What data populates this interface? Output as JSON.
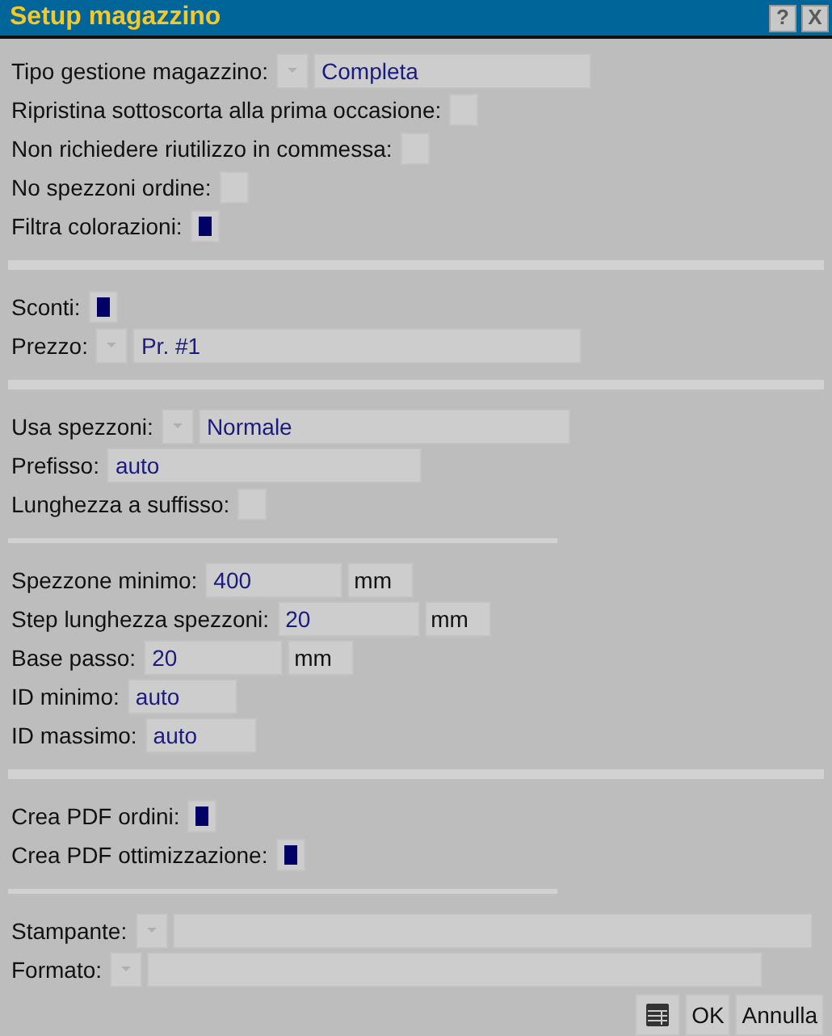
{
  "window": {
    "title": "Setup magazzino",
    "buttons": [
      "?",
      "X"
    ]
  },
  "sections": [
    {
      "rows": [
        {
          "kind": "dropdown",
          "label": "Tipo gestione magazzino:",
          "value": "Completa"
        },
        {
          "kind": "checkbox",
          "label": "Ripristina sottoscorta alla prima occasione:",
          "checked": false
        },
        {
          "kind": "checkbox",
          "label": "Non richiedere riutilizzo in commessa:",
          "checked": false
        },
        {
          "kind": "checkbox",
          "label": "No spezzoni ordine:",
          "checked": false
        },
        {
          "kind": "checkbox",
          "label": "Filtra colorazioni:",
          "checked": true
        }
      ]
    },
    {
      "rows": [
        {
          "kind": "checkbox",
          "label": "Sconti:",
          "checked": true
        },
        {
          "kind": "dropdown",
          "label": "Prezzo:",
          "value": "Pr. #1"
        }
      ]
    },
    {
      "rows": [
        {
          "kind": "dropdown",
          "label": "Usa spezzoni:",
          "value": "Normale"
        },
        {
          "kind": "text",
          "label": "Prefisso:",
          "value": "auto"
        },
        {
          "kind": "checkbox",
          "label": "Lunghezza a suffisso:",
          "checked": false
        }
      ]
    },
    {
      "rows": [
        {
          "kind": "text",
          "label": "Spezzone minimo:",
          "value": "400",
          "unit": "mm"
        },
        {
          "kind": "text",
          "label": "Step lunghezza spezzoni:",
          "value": "20",
          "unit": "mm"
        },
        {
          "kind": "text",
          "label": "Base passo:",
          "value": "20",
          "unit": "mm"
        },
        {
          "kind": "text",
          "label": "ID minimo:",
          "value": "auto"
        },
        {
          "kind": "text",
          "label": "ID massimo:",
          "value": "auto"
        }
      ]
    },
    {
      "rows": [
        {
          "kind": "checkbox",
          "label": "Crea PDF ordini:",
          "checked": true
        },
        {
          "kind": "checkbox",
          "label": "Crea PDF ottimizzazione:",
          "checked": true
        }
      ]
    },
    {
      "rows": [
        {
          "kind": "dropdown",
          "label": "Stampante:"
        },
        {
          "kind": "dropdown",
          "label": "Formato:"
        }
      ]
    }
  ],
  "footer": {
    "buttons": [
      "OK",
      "Annulla"
    ]
  }
}
